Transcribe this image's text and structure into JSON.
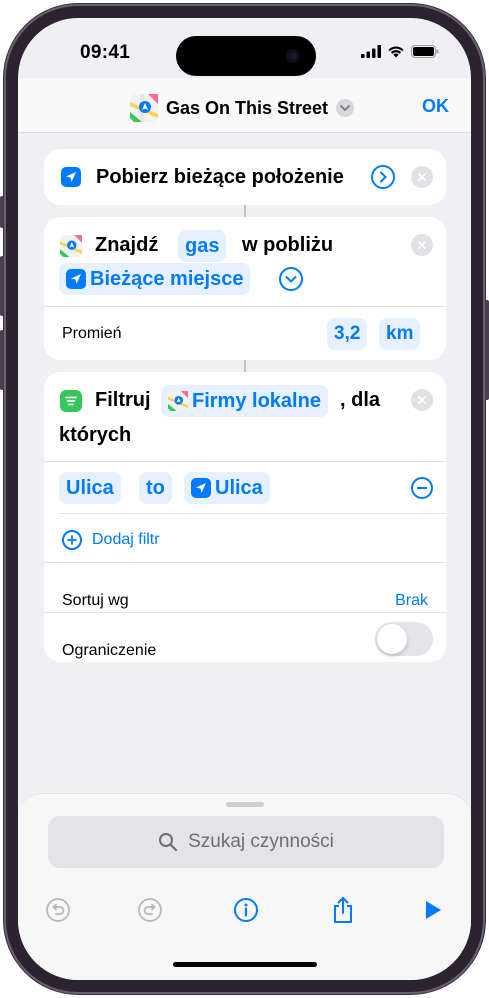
{
  "status_bar": {
    "time": "09:41"
  },
  "nav": {
    "title": "Gas On This Street",
    "ok": "OK"
  },
  "action1": {
    "label": "Pobierz bieżące położenie"
  },
  "action2": {
    "verb": "Znajdź",
    "query": "gas",
    "near": "w pobliżu",
    "location": "Bieżące miejsce",
    "radius_label": "Promień",
    "radius_value": "3,2",
    "radius_unit": "km"
  },
  "action3": {
    "verb": "Filtruj",
    "input": "Firmy lokalne",
    "suffix": ", dla",
    "suffix2": "których",
    "filter_field": "Ulica",
    "filter_op": "to",
    "filter_value": "Ulica",
    "add_filter": "Dodaj filtr",
    "sort_label": "Sortuj wg",
    "sort_value": "Brak",
    "limit_label": "Ograniczenie",
    "limit_enabled": false
  },
  "bottom_sheet": {
    "search_placeholder": "Szukaj czynności"
  },
  "colors": {
    "accent": "#007aff",
    "background": "#efeff4"
  },
  "icons": {
    "status": [
      "cellular-icon",
      "wifi-icon",
      "battery-icon"
    ],
    "toolbar": [
      "undo-icon",
      "redo-icon",
      "info-icon",
      "share-icon",
      "play-icon"
    ]
  }
}
